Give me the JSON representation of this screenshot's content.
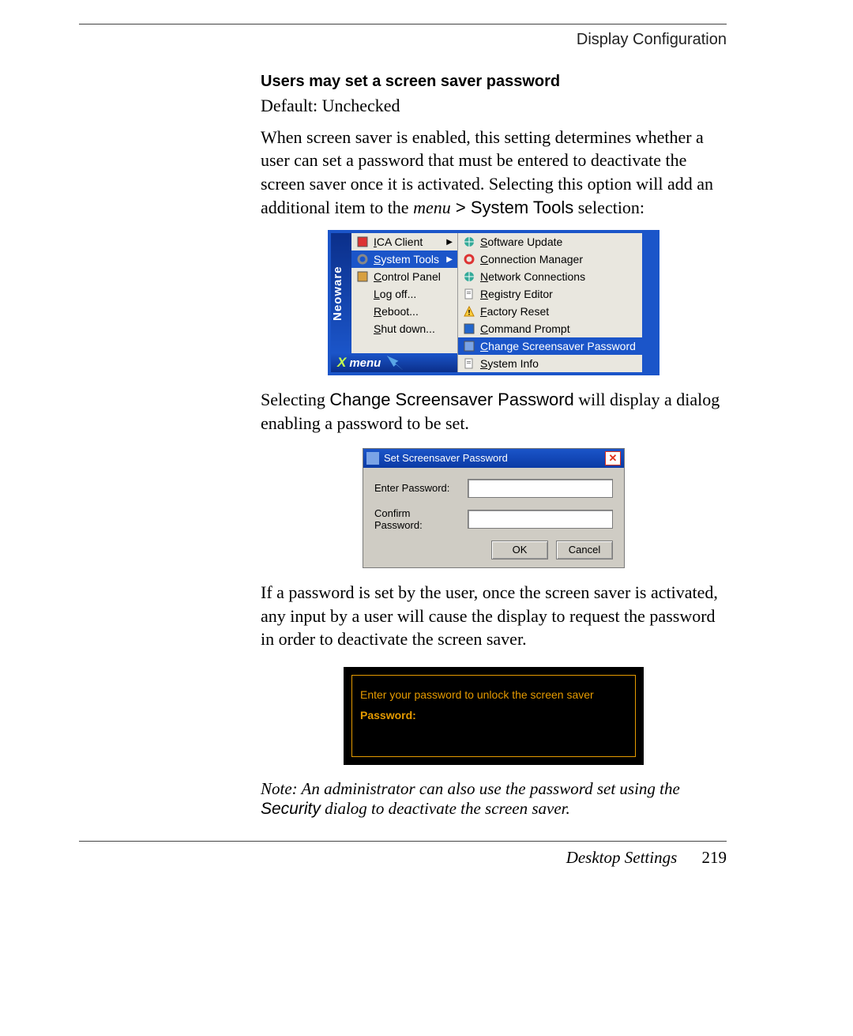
{
  "header": {
    "section_label": "Display Configuration"
  },
  "section": {
    "title": "Users may set a screen saver password",
    "default_line": "Default: Unchecked",
    "para1_a": "When screen saver is enabled, this setting determines whether a user can set a password that must be entered to deactivate the screen saver once it is activated. Selecting this option will add an additional item to the ",
    "para1_menu_word": "menu",
    "para1_gt": " > ",
    "para1_sys_tools": "System Tools",
    "para1_tail": " selection:",
    "para2_a": "Selecting ",
    "para2_cmd": "Change Screensaver Password",
    "para2_b": " will display a dialog enabling a password to be set.",
    "para3": "If a password is set by the user, once the screen saver is activated, any input by a user will cause the display to request the password in order to deactivate the screen saver.",
    "note_a": "Note: An administrator can also use the password set using the ",
    "note_security": "Security",
    "note_b": " dialog to deactivate the screen saver."
  },
  "menu": {
    "brand": "Neoware",
    "footer": "menu",
    "left": [
      {
        "label": "ICA Client",
        "underline": "I",
        "arrow": true
      },
      {
        "label": "System Tools",
        "underline": "S",
        "arrow": true,
        "highlight": true
      },
      {
        "label": "Control Panel",
        "underline": "C"
      },
      {
        "label": "Log off...",
        "underline": "L"
      },
      {
        "label": "Reboot...",
        "underline": "R"
      },
      {
        "label": "Shut down...",
        "underline": "S"
      }
    ],
    "right": [
      {
        "label": "Software Update",
        "underline": "S"
      },
      {
        "label": "Connection Manager",
        "underline": "C"
      },
      {
        "label": "Network Connections",
        "underline": "N"
      },
      {
        "label": "Registry Editor",
        "underline": "R"
      },
      {
        "label": "Factory Reset",
        "underline": "F"
      },
      {
        "label": "Command Prompt",
        "underline": "C"
      },
      {
        "label": "Change Screensaver Password",
        "underline": "C",
        "highlight": true
      },
      {
        "label": "System Info",
        "underline": "S"
      }
    ]
  },
  "dialog": {
    "title": "Set Screensaver Password",
    "enter_label": "Enter Password:",
    "confirm_label": "Confirm Password:",
    "ok": "OK",
    "cancel": "Cancel"
  },
  "unlock": {
    "message": "Enter your password to unlock the screen saver",
    "password_label": "Password:"
  },
  "footer": {
    "chapter": "Desktop Settings",
    "page": "219"
  }
}
